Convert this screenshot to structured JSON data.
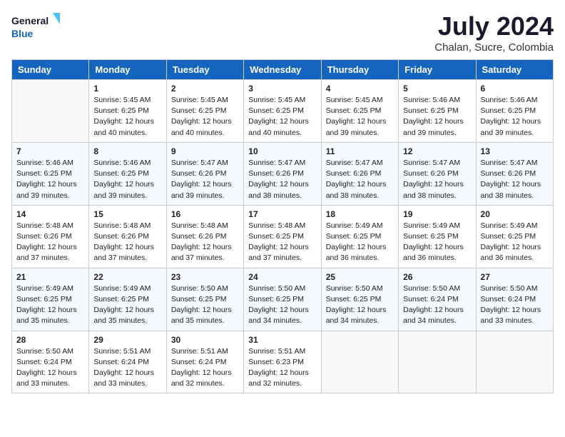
{
  "header": {
    "logo_line1": "General",
    "logo_line2": "Blue",
    "month": "July 2024",
    "location": "Chalan, Sucre, Colombia"
  },
  "weekdays": [
    "Sunday",
    "Monday",
    "Tuesday",
    "Wednesday",
    "Thursday",
    "Friday",
    "Saturday"
  ],
  "weeks": [
    [
      {
        "day": "",
        "sunrise": "",
        "sunset": "",
        "daylight": ""
      },
      {
        "day": "1",
        "sunrise": "Sunrise: 5:45 AM",
        "sunset": "Sunset: 6:25 PM",
        "daylight": "Daylight: 12 hours",
        "daylight2": "and 40 minutes."
      },
      {
        "day": "2",
        "sunrise": "Sunrise: 5:45 AM",
        "sunset": "Sunset: 6:25 PM",
        "daylight": "Daylight: 12 hours",
        "daylight2": "and 40 minutes."
      },
      {
        "day": "3",
        "sunrise": "Sunrise: 5:45 AM",
        "sunset": "Sunset: 6:25 PM",
        "daylight": "Daylight: 12 hours",
        "daylight2": "and 40 minutes."
      },
      {
        "day": "4",
        "sunrise": "Sunrise: 5:45 AM",
        "sunset": "Sunset: 6:25 PM",
        "daylight": "Daylight: 12 hours",
        "daylight2": "and 39 minutes."
      },
      {
        "day": "5",
        "sunrise": "Sunrise: 5:46 AM",
        "sunset": "Sunset: 6:25 PM",
        "daylight": "Daylight: 12 hours",
        "daylight2": "and 39 minutes."
      },
      {
        "day": "6",
        "sunrise": "Sunrise: 5:46 AM",
        "sunset": "Sunset: 6:25 PM",
        "daylight": "Daylight: 12 hours",
        "daylight2": "and 39 minutes."
      }
    ],
    [
      {
        "day": "7",
        "sunrise": "Sunrise: 5:46 AM",
        "sunset": "Sunset: 6:25 PM",
        "daylight": "Daylight: 12 hours",
        "daylight2": "and 39 minutes."
      },
      {
        "day": "8",
        "sunrise": "Sunrise: 5:46 AM",
        "sunset": "Sunset: 6:25 PM",
        "daylight": "Daylight: 12 hours",
        "daylight2": "and 39 minutes."
      },
      {
        "day": "9",
        "sunrise": "Sunrise: 5:47 AM",
        "sunset": "Sunset: 6:26 PM",
        "daylight": "Daylight: 12 hours",
        "daylight2": "and 39 minutes."
      },
      {
        "day": "10",
        "sunrise": "Sunrise: 5:47 AM",
        "sunset": "Sunset: 6:26 PM",
        "daylight": "Daylight: 12 hours",
        "daylight2": "and 38 minutes."
      },
      {
        "day": "11",
        "sunrise": "Sunrise: 5:47 AM",
        "sunset": "Sunset: 6:26 PM",
        "daylight": "Daylight: 12 hours",
        "daylight2": "and 38 minutes."
      },
      {
        "day": "12",
        "sunrise": "Sunrise: 5:47 AM",
        "sunset": "Sunset: 6:26 PM",
        "daylight": "Daylight: 12 hours",
        "daylight2": "and 38 minutes."
      },
      {
        "day": "13",
        "sunrise": "Sunrise: 5:47 AM",
        "sunset": "Sunset: 6:26 PM",
        "daylight": "Daylight: 12 hours",
        "daylight2": "and 38 minutes."
      }
    ],
    [
      {
        "day": "14",
        "sunrise": "Sunrise: 5:48 AM",
        "sunset": "Sunset: 6:26 PM",
        "daylight": "Daylight: 12 hours",
        "daylight2": "and 37 minutes."
      },
      {
        "day": "15",
        "sunrise": "Sunrise: 5:48 AM",
        "sunset": "Sunset: 6:26 PM",
        "daylight": "Daylight: 12 hours",
        "daylight2": "and 37 minutes."
      },
      {
        "day": "16",
        "sunrise": "Sunrise: 5:48 AM",
        "sunset": "Sunset: 6:26 PM",
        "daylight": "Daylight: 12 hours",
        "daylight2": "and 37 minutes."
      },
      {
        "day": "17",
        "sunrise": "Sunrise: 5:48 AM",
        "sunset": "Sunset: 6:25 PM",
        "daylight": "Daylight: 12 hours",
        "daylight2": "and 37 minutes."
      },
      {
        "day": "18",
        "sunrise": "Sunrise: 5:49 AM",
        "sunset": "Sunset: 6:25 PM",
        "daylight": "Daylight: 12 hours",
        "daylight2": "and 36 minutes."
      },
      {
        "day": "19",
        "sunrise": "Sunrise: 5:49 AM",
        "sunset": "Sunset: 6:25 PM",
        "daylight": "Daylight: 12 hours",
        "daylight2": "and 36 minutes."
      },
      {
        "day": "20",
        "sunrise": "Sunrise: 5:49 AM",
        "sunset": "Sunset: 6:25 PM",
        "daylight": "Daylight: 12 hours",
        "daylight2": "and 36 minutes."
      }
    ],
    [
      {
        "day": "21",
        "sunrise": "Sunrise: 5:49 AM",
        "sunset": "Sunset: 6:25 PM",
        "daylight": "Daylight: 12 hours",
        "daylight2": "and 35 minutes."
      },
      {
        "day": "22",
        "sunrise": "Sunrise: 5:49 AM",
        "sunset": "Sunset: 6:25 PM",
        "daylight": "Daylight: 12 hours",
        "daylight2": "and 35 minutes."
      },
      {
        "day": "23",
        "sunrise": "Sunrise: 5:50 AM",
        "sunset": "Sunset: 6:25 PM",
        "daylight": "Daylight: 12 hours",
        "daylight2": "and 35 minutes."
      },
      {
        "day": "24",
        "sunrise": "Sunrise: 5:50 AM",
        "sunset": "Sunset: 6:25 PM",
        "daylight": "Daylight: 12 hours",
        "daylight2": "and 34 minutes."
      },
      {
        "day": "25",
        "sunrise": "Sunrise: 5:50 AM",
        "sunset": "Sunset: 6:25 PM",
        "daylight": "Daylight: 12 hours",
        "daylight2": "and 34 minutes."
      },
      {
        "day": "26",
        "sunrise": "Sunrise: 5:50 AM",
        "sunset": "Sunset: 6:24 PM",
        "daylight": "Daylight: 12 hours",
        "daylight2": "and 34 minutes."
      },
      {
        "day": "27",
        "sunrise": "Sunrise: 5:50 AM",
        "sunset": "Sunset: 6:24 PM",
        "daylight": "Daylight: 12 hours",
        "daylight2": "and 33 minutes."
      }
    ],
    [
      {
        "day": "28",
        "sunrise": "Sunrise: 5:50 AM",
        "sunset": "Sunset: 6:24 PM",
        "daylight": "Daylight: 12 hours",
        "daylight2": "and 33 minutes."
      },
      {
        "day": "29",
        "sunrise": "Sunrise: 5:51 AM",
        "sunset": "Sunset: 6:24 PM",
        "daylight": "Daylight: 12 hours",
        "daylight2": "and 33 minutes."
      },
      {
        "day": "30",
        "sunrise": "Sunrise: 5:51 AM",
        "sunset": "Sunset: 6:24 PM",
        "daylight": "Daylight: 12 hours",
        "daylight2": "and 32 minutes."
      },
      {
        "day": "31",
        "sunrise": "Sunrise: 5:51 AM",
        "sunset": "Sunset: 6:23 PM",
        "daylight": "Daylight: 12 hours",
        "daylight2": "and 32 minutes."
      },
      {
        "day": "",
        "sunrise": "",
        "sunset": "",
        "daylight": "",
        "daylight2": ""
      },
      {
        "day": "",
        "sunrise": "",
        "sunset": "",
        "daylight": "",
        "daylight2": ""
      },
      {
        "day": "",
        "sunrise": "",
        "sunset": "",
        "daylight": "",
        "daylight2": ""
      }
    ]
  ]
}
